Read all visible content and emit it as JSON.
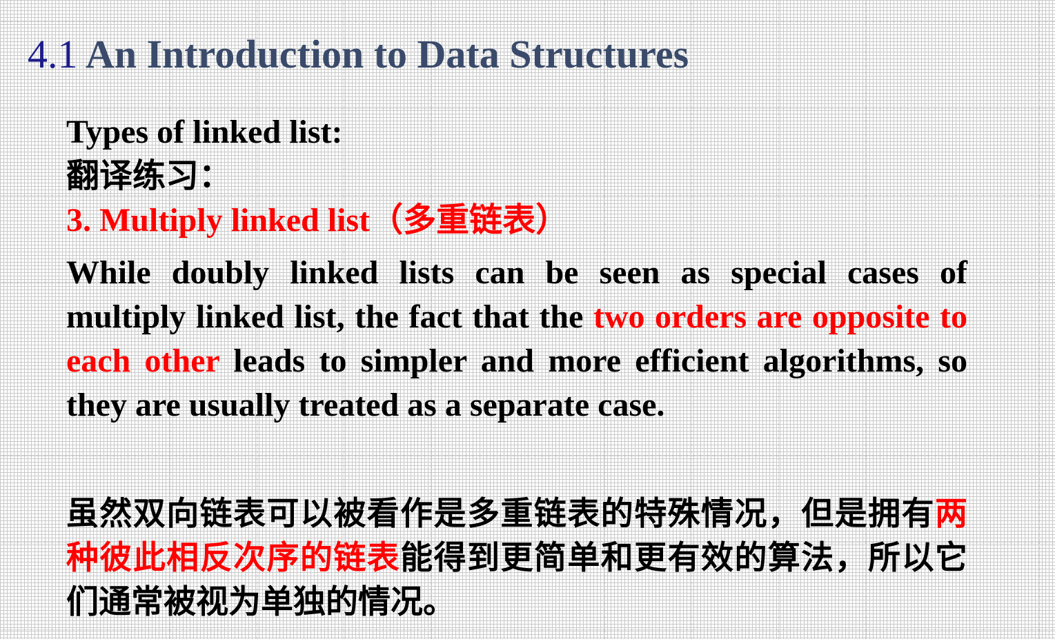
{
  "slide": {
    "title_number": "4.1",
    "title_text": "An Introduction to Data Structures"
  },
  "content": {
    "heading_types": "Types of linked list:",
    "heading_exercise": "翻译练习：",
    "item_heading": "3. Multiply linked list（多重链表）",
    "english": {
      "part1": "While doubly linked lists can be seen as special cases of multiply linked list, the fact that the ",
      "highlight": "two orders are opposite to each other",
      "part2": " leads to simpler and more efficient algorithms, so they are usually treated as a separate case."
    },
    "chinese": {
      "part1": "虽然双向链表可以被看作是多重链表的特殊情况，但是拥有",
      "highlight": "两种彼此相反次序的链表",
      "part2": "能得到更简单和更有效的算法，所以它们通常被视为单独的情况。"
    }
  },
  "colors": {
    "title_number": "#1c1c8c",
    "title_text": "#3a4a6a",
    "body_text": "#000000",
    "highlight": "#ff0000"
  }
}
